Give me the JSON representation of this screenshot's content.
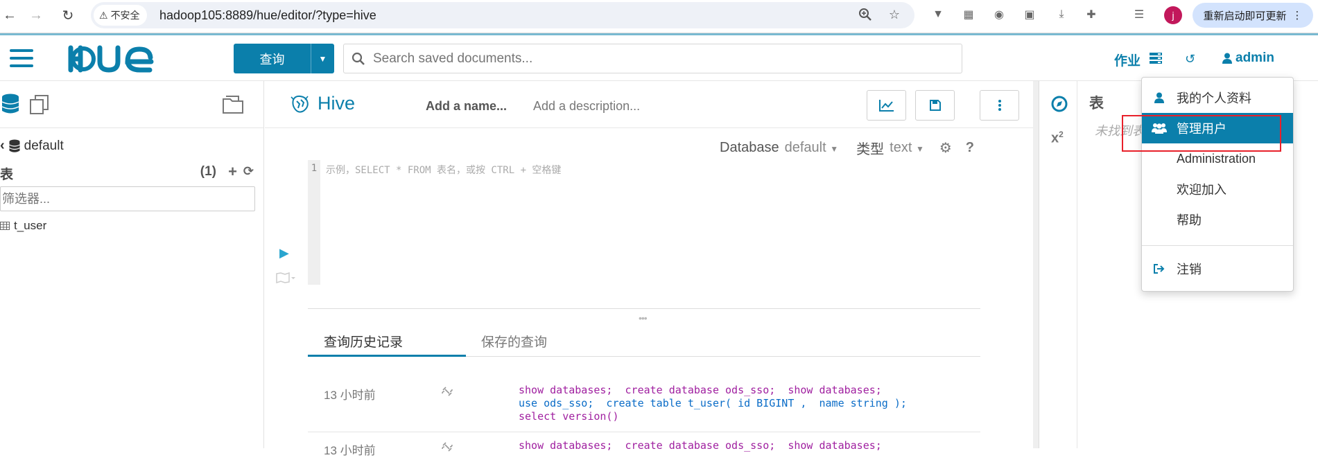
{
  "browser": {
    "security_label": "不安全",
    "url": "hadoop105:8889/hue/editor/?type=hive",
    "profile_initial": "j",
    "update_button": "重新启动即可更新"
  },
  "header": {
    "logo_text": "HUE",
    "query_button": "查询",
    "search_placeholder": "Search saved documents...",
    "jobs_label": "作业",
    "user_label": "admin"
  },
  "left_panel": {
    "database": "default",
    "tables_label": "表",
    "tables_count": "(1)",
    "filter_placeholder": "筛选器...",
    "tables": [
      "t_user"
    ]
  },
  "editor": {
    "type_title": "Hive",
    "name_placeholder": "Add a name...",
    "description_placeholder": "Add a description...",
    "database_label": "Database",
    "database_value": "default",
    "type_label": "类型",
    "type_value": "text",
    "line_number": "1",
    "code_placeholder": "示例，SELECT * FROM 表名，或按 CTRL + 空格键",
    "tabs": {
      "history": "查询历史记录",
      "saved": "保存的查询"
    },
    "history": [
      {
        "time": "13 小时前",
        "line1_a": "show databases;",
        "line1_b": "create database ods_sso;",
        "line1_c": "show databases;",
        "line2": "use ods_sso;  create table t_user( id BIGINT ,  name string );",
        "line3": "select version()"
      },
      {
        "time": "13 小时前",
        "line1_a": "show databases;",
        "line1_b": "create database ods_sso;",
        "line1_c": "show databases;"
      }
    ]
  },
  "right_panel": {
    "title": "表",
    "empty_text": "未找到表"
  },
  "user_menu": {
    "items": [
      {
        "label": "我的个人资料",
        "icon": "user-icon"
      },
      {
        "label": "管理用户",
        "icon": "users-icon"
      },
      {
        "label": "Administration",
        "icon": ""
      },
      {
        "label": "欢迎加入",
        "icon": ""
      },
      {
        "label": "帮助",
        "icon": ""
      },
      {
        "label": "注销",
        "icon": "sign-out-icon"
      }
    ]
  },
  "colors": {
    "accent": "#0b7fab",
    "highlight": "#e8202a"
  }
}
